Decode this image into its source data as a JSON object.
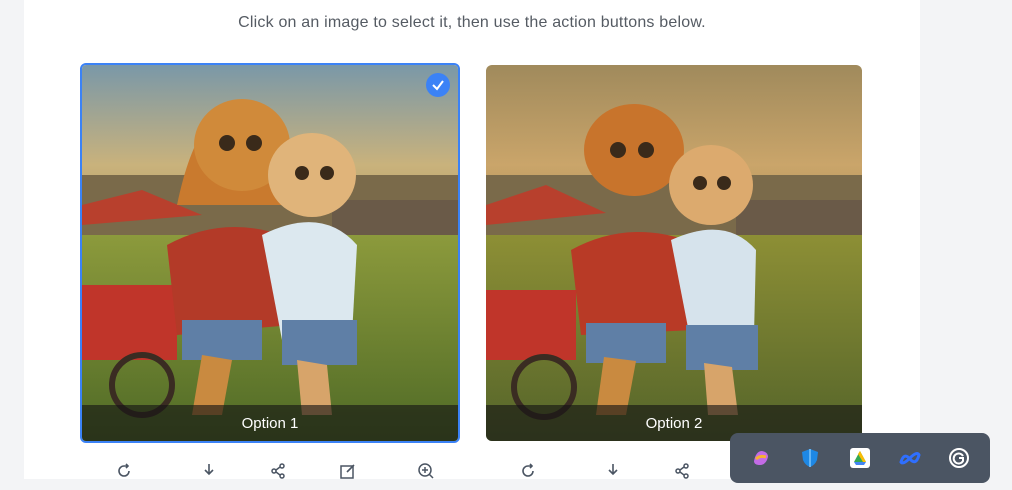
{
  "instruction": "Click on an image to select it, then use the action buttons below.",
  "options": [
    {
      "label": "Option 1",
      "selected": true
    },
    {
      "label": "Option 2",
      "selected": false
    }
  ],
  "action_icons": [
    "refresh-icon",
    "download-icon",
    "share-icon",
    "edit-icon",
    "zoom-in-icon"
  ],
  "tray_icons": [
    "copilot-icon",
    "shield-icon",
    "google-drive-icon",
    "meta-icon",
    "grammarly-icon"
  ],
  "colors": {
    "accent": "#3b82f6",
    "tray": "#4b5563"
  }
}
